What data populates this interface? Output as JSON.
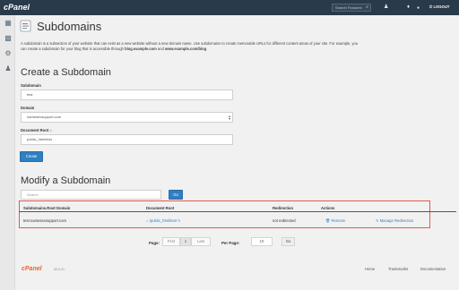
{
  "topbar": {
    "logo": "cPanel",
    "search_placeholder": "Search Features",
    "logout_label": "LOGOUT"
  },
  "page": {
    "title": "Subdomains",
    "intro_line1_pre": "A subdomain is a subsection of your website that can exist as a new website without a new domain name. Use subdomains to create memorable URLs for different content areas of your site. For example, you",
    "intro_line2_pre": "can create a subdomain for your blog that is accessible through ",
    "intro_ex1": "blog.example.com",
    "intro_and": " and ",
    "intro_ex2": "www.example.com/blog",
    "intro_end": "."
  },
  "create": {
    "heading": "Create a Subdomain",
    "subdomain_label": "Subdomain",
    "subdomain_value": "test",
    "domain_label": "Domain",
    "domain_value": "namesexsupport.com",
    "docroot_label": "Document Root",
    "docroot_value": "public_html/test",
    "create_button": "Create"
  },
  "modify": {
    "heading": "Modify a Subdomain",
    "search_placeholder": "Search",
    "go_button": "Go",
    "columns": [
      "Subdomains.Root Domain",
      "Document Root",
      "Redirection",
      "Actions"
    ],
    "rows": [
      {
        "subdomain": "test.namesexsupport.com",
        "docroot": "/public_html/test",
        "redirection": "not redirected",
        "remove": "Remove",
        "manage": "Manage Redirection"
      }
    ]
  },
  "pager": {
    "page_label": "Page:",
    "first": "First",
    "current": "1",
    "last": "Last",
    "per_page_label": "Per Page:",
    "per_page_value": "10",
    "go_button": "Go"
  },
  "footer": {
    "logo": "cPanel",
    "version": "54.0.21",
    "links": [
      "Home",
      "Trademarks",
      "Documentation"
    ]
  },
  "colors": {
    "topbar": "#293a4a",
    "button": "#2f7fc1",
    "highlight_border": "#e05a4c",
    "footer_logo": "#e8642a"
  }
}
